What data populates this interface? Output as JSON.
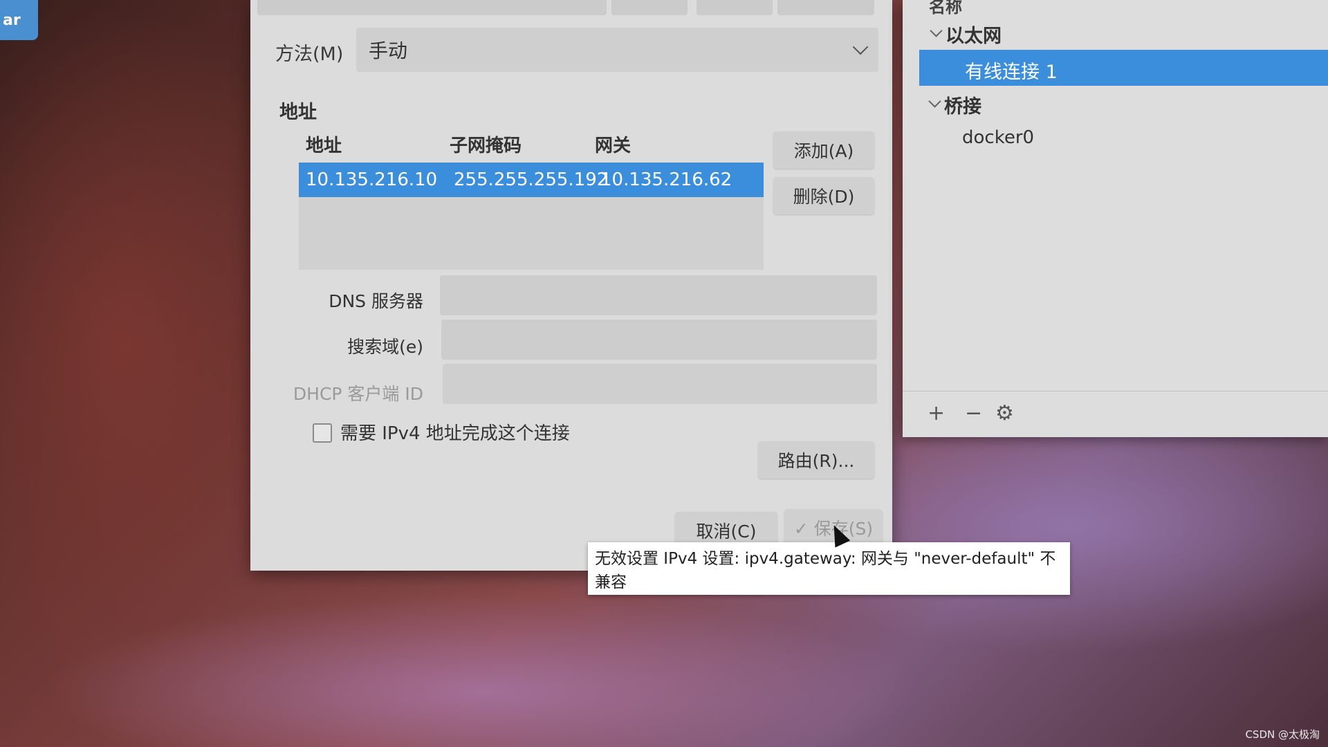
{
  "desktop": {
    "corner_button_label": "ar"
  },
  "dialog": {
    "method_label": "方法(M)",
    "method_value": "手动",
    "addresses_heading": "地址",
    "table": {
      "headers": [
        "地址",
        "子网掩码",
        "网关"
      ],
      "rows": [
        {
          "address": "10.135.216.10",
          "netmask": "255.255.255.192",
          "gateway": "10.135.216.62"
        }
      ]
    },
    "add_button": "添加(A)",
    "delete_button": "删除(D)",
    "dns_label": "DNS 服务器",
    "dns_value": "",
    "search_domain_label": "搜索域(e)",
    "search_domain_value": "",
    "dhcp_client_id_label": "DHCP 客户端 ID",
    "dhcp_client_id_value": "",
    "require_ipv4_label": "需要 IPv4 地址完成这个连接",
    "routes_button": "路由(R)...",
    "cancel_button": "取消(C)",
    "save_button": "✓ 保存(S)",
    "tooltip": "无效设置 IPv4 设置: ipv4.gateway: 网关与 \"never-default\" 不兼容"
  },
  "connections_panel": {
    "column_header": "名称",
    "groups": [
      {
        "name": "以太网",
        "items": [
          "有线连接 1"
        ]
      },
      {
        "name": "桥接",
        "items": [
          "docker0"
        ]
      }
    ],
    "selected": "有线连接 1",
    "footer_icons": [
      "plus-icon",
      "minus-icon",
      "gear-icon"
    ]
  },
  "watermark": "CSDN @太极淘",
  "colors": {
    "selection": "#3a8edb",
    "dialog_bg": "#dcdcdc"
  }
}
